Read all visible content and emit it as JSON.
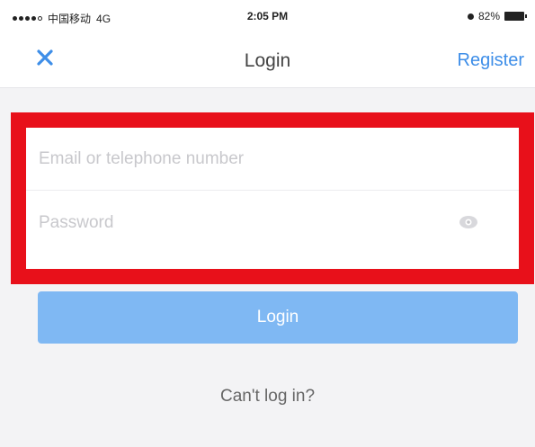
{
  "status_bar": {
    "carrier": "中国移动",
    "network": "4G",
    "time": "2:05 PM",
    "battery": "82%"
  },
  "nav": {
    "close_icon": "close-x-icon",
    "title": "Login",
    "register_label": "Register"
  },
  "form": {
    "email_placeholder": "Email or telephone number",
    "email_value": "",
    "password_placeholder": "Password",
    "password_value": "",
    "password_toggle_icon": "eye-icon"
  },
  "login_button_label": "Login",
  "cant_login_label": "Can't log in?",
  "colors": {
    "accent": "#3e8ee8",
    "login_button": "#7fb8f3",
    "highlight": "#e8101a"
  }
}
